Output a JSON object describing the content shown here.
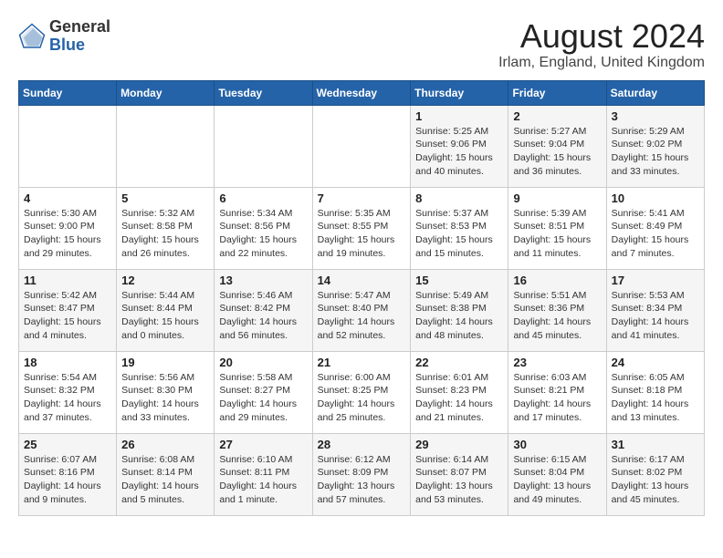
{
  "header": {
    "logo_general": "General",
    "logo_blue": "Blue",
    "month_year": "August 2024",
    "location": "Irlam, England, United Kingdom"
  },
  "weekdays": [
    "Sunday",
    "Monday",
    "Tuesday",
    "Wednesday",
    "Thursday",
    "Friday",
    "Saturday"
  ],
  "weeks": [
    [
      {
        "day": "",
        "detail": ""
      },
      {
        "day": "",
        "detail": ""
      },
      {
        "day": "",
        "detail": ""
      },
      {
        "day": "",
        "detail": ""
      },
      {
        "day": "1",
        "detail": "Sunrise: 5:25 AM\nSunset: 9:06 PM\nDaylight: 15 hours\nand 40 minutes."
      },
      {
        "day": "2",
        "detail": "Sunrise: 5:27 AM\nSunset: 9:04 PM\nDaylight: 15 hours\nand 36 minutes."
      },
      {
        "day": "3",
        "detail": "Sunrise: 5:29 AM\nSunset: 9:02 PM\nDaylight: 15 hours\nand 33 minutes."
      }
    ],
    [
      {
        "day": "4",
        "detail": "Sunrise: 5:30 AM\nSunset: 9:00 PM\nDaylight: 15 hours\nand 29 minutes."
      },
      {
        "day": "5",
        "detail": "Sunrise: 5:32 AM\nSunset: 8:58 PM\nDaylight: 15 hours\nand 26 minutes."
      },
      {
        "day": "6",
        "detail": "Sunrise: 5:34 AM\nSunset: 8:56 PM\nDaylight: 15 hours\nand 22 minutes."
      },
      {
        "day": "7",
        "detail": "Sunrise: 5:35 AM\nSunset: 8:55 PM\nDaylight: 15 hours\nand 19 minutes."
      },
      {
        "day": "8",
        "detail": "Sunrise: 5:37 AM\nSunset: 8:53 PM\nDaylight: 15 hours\nand 15 minutes."
      },
      {
        "day": "9",
        "detail": "Sunrise: 5:39 AM\nSunset: 8:51 PM\nDaylight: 15 hours\nand 11 minutes."
      },
      {
        "day": "10",
        "detail": "Sunrise: 5:41 AM\nSunset: 8:49 PM\nDaylight: 15 hours\nand 7 minutes."
      }
    ],
    [
      {
        "day": "11",
        "detail": "Sunrise: 5:42 AM\nSunset: 8:47 PM\nDaylight: 15 hours\nand 4 minutes."
      },
      {
        "day": "12",
        "detail": "Sunrise: 5:44 AM\nSunset: 8:44 PM\nDaylight: 15 hours\nand 0 minutes."
      },
      {
        "day": "13",
        "detail": "Sunrise: 5:46 AM\nSunset: 8:42 PM\nDaylight: 14 hours\nand 56 minutes."
      },
      {
        "day": "14",
        "detail": "Sunrise: 5:47 AM\nSunset: 8:40 PM\nDaylight: 14 hours\nand 52 minutes."
      },
      {
        "day": "15",
        "detail": "Sunrise: 5:49 AM\nSunset: 8:38 PM\nDaylight: 14 hours\nand 48 minutes."
      },
      {
        "day": "16",
        "detail": "Sunrise: 5:51 AM\nSunset: 8:36 PM\nDaylight: 14 hours\nand 45 minutes."
      },
      {
        "day": "17",
        "detail": "Sunrise: 5:53 AM\nSunset: 8:34 PM\nDaylight: 14 hours\nand 41 minutes."
      }
    ],
    [
      {
        "day": "18",
        "detail": "Sunrise: 5:54 AM\nSunset: 8:32 PM\nDaylight: 14 hours\nand 37 minutes."
      },
      {
        "day": "19",
        "detail": "Sunrise: 5:56 AM\nSunset: 8:30 PM\nDaylight: 14 hours\nand 33 minutes."
      },
      {
        "day": "20",
        "detail": "Sunrise: 5:58 AM\nSunset: 8:27 PM\nDaylight: 14 hours\nand 29 minutes."
      },
      {
        "day": "21",
        "detail": "Sunrise: 6:00 AM\nSunset: 8:25 PM\nDaylight: 14 hours\nand 25 minutes."
      },
      {
        "day": "22",
        "detail": "Sunrise: 6:01 AM\nSunset: 8:23 PM\nDaylight: 14 hours\nand 21 minutes."
      },
      {
        "day": "23",
        "detail": "Sunrise: 6:03 AM\nSunset: 8:21 PM\nDaylight: 14 hours\nand 17 minutes."
      },
      {
        "day": "24",
        "detail": "Sunrise: 6:05 AM\nSunset: 8:18 PM\nDaylight: 14 hours\nand 13 minutes."
      }
    ],
    [
      {
        "day": "25",
        "detail": "Sunrise: 6:07 AM\nSunset: 8:16 PM\nDaylight: 14 hours\nand 9 minutes."
      },
      {
        "day": "26",
        "detail": "Sunrise: 6:08 AM\nSunset: 8:14 PM\nDaylight: 14 hours\nand 5 minutes."
      },
      {
        "day": "27",
        "detail": "Sunrise: 6:10 AM\nSunset: 8:11 PM\nDaylight: 14 hours\nand 1 minute."
      },
      {
        "day": "28",
        "detail": "Sunrise: 6:12 AM\nSunset: 8:09 PM\nDaylight: 13 hours\nand 57 minutes."
      },
      {
        "day": "29",
        "detail": "Sunrise: 6:14 AM\nSunset: 8:07 PM\nDaylight: 13 hours\nand 53 minutes."
      },
      {
        "day": "30",
        "detail": "Sunrise: 6:15 AM\nSunset: 8:04 PM\nDaylight: 13 hours\nand 49 minutes."
      },
      {
        "day": "31",
        "detail": "Sunrise: 6:17 AM\nSunset: 8:02 PM\nDaylight: 13 hours\nand 45 minutes."
      }
    ]
  ]
}
